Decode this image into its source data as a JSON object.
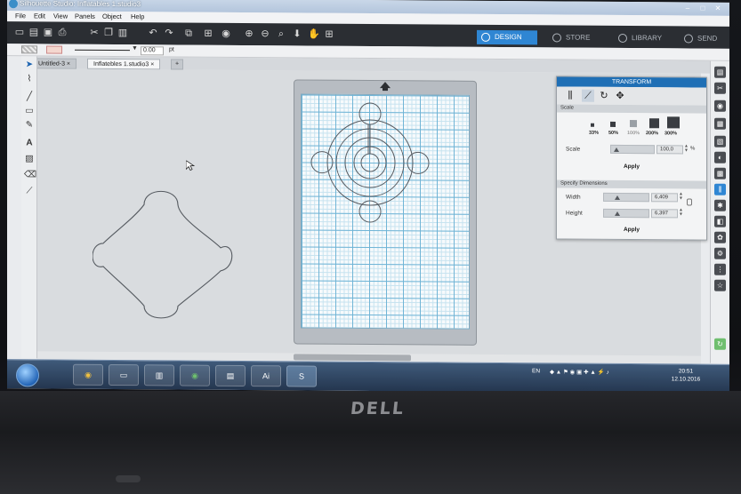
{
  "window": {
    "title": "Silhouette Studio: Inflatables 1.studio3",
    "controls": [
      "–",
      "□",
      "✕"
    ]
  },
  "menu": {
    "items": [
      "File",
      "Edit",
      "View",
      "Panels",
      "Object",
      "Help"
    ]
  },
  "toolbar": {
    "icons": [
      "new-icon",
      "open-icon",
      "save-icon",
      "print-icon",
      "cut-icon",
      "copy-icon",
      "paste-icon",
      "undo-icon",
      "redo-icon",
      "group-icon",
      "ungroup-icon",
      "replicate-icon",
      "zoom-in-icon",
      "zoom-out-icon",
      "zoom-fit-icon",
      "move-down-icon",
      "pan-icon",
      "add-page-icon"
    ],
    "nav_tabs": [
      {
        "label": "DESIGN",
        "active": true
      },
      {
        "label": "STORE",
        "active": false
      },
      {
        "label": "LIBRARY",
        "active": false
      },
      {
        "label": "SEND",
        "active": false
      }
    ]
  },
  "options": {
    "line_width": "0.00",
    "unit": "pt"
  },
  "doc_tabs": [
    {
      "label": "Untitled-3",
      "active": false
    },
    {
      "label": "Inflatebles 1.studio3",
      "active": true
    }
  ],
  "doc_tab_add": "+",
  "transform_panel": {
    "title": "TRANSFORM",
    "section_scale": "Scale",
    "scale_presets": [
      "33%",
      "50%",
      "100%",
      "200%",
      "300%"
    ],
    "scale_label": "Scale",
    "scale_value": "100,0",
    "scale_unit": "%",
    "apply_label": "Apply",
    "section_dimensions": "Specify Dimensions",
    "width_label": "Width",
    "width_value": "6,409",
    "height_label": "Height",
    "height_value": "6,397",
    "apply_label_2": "Apply"
  },
  "taskbar": {
    "apps": [
      "chrome",
      "folder",
      "app",
      "chrome",
      "explorer",
      "Ai",
      "S"
    ],
    "tray_lang": "EN",
    "time": "20:51",
    "date": "12.10.2016"
  },
  "bezel": {
    "brand": "DELL"
  },
  "colors": {
    "accent": "#2f86d3",
    "panel_header": "#1f6fb5",
    "mat_grid": "#6fb4d6",
    "shape_stroke": "#555a60"
  }
}
